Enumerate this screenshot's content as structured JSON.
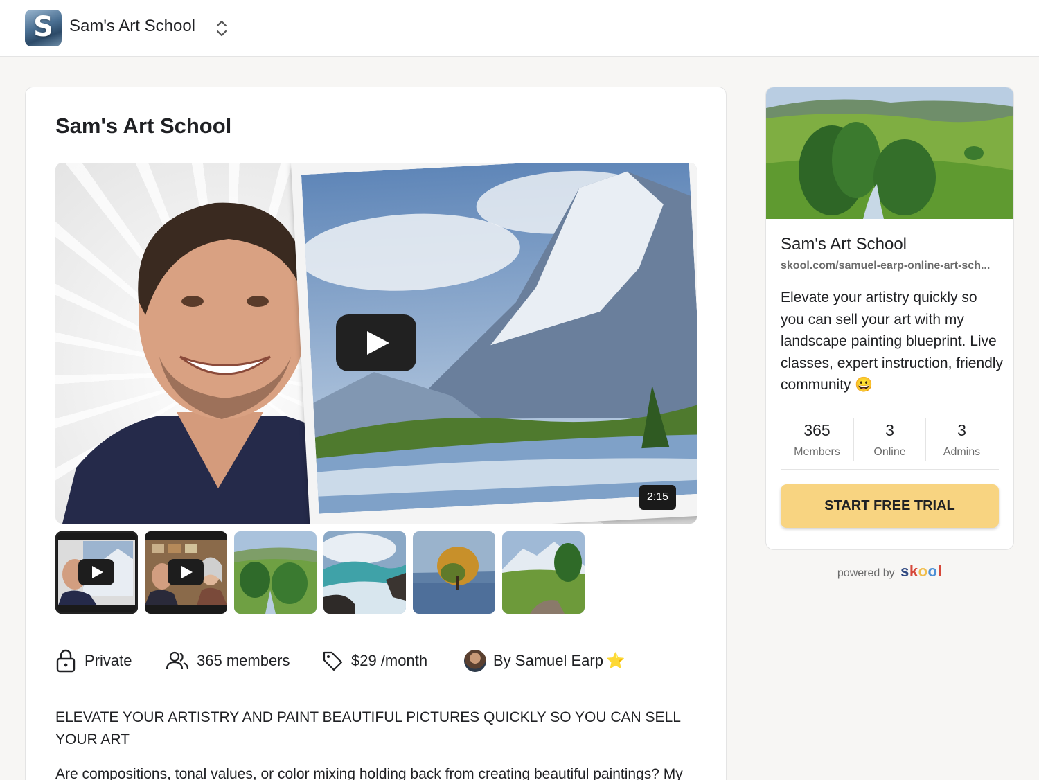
{
  "header": {
    "logo_letter": "S",
    "brand": "Sam's Art School",
    "switcher_icon": "chevron-up-down-icon"
  },
  "main": {
    "title": "Sam's Art School",
    "video": {
      "duration": "2:15",
      "play_icon": "play-icon"
    },
    "thumbnails": [
      {
        "kind": "video",
        "subject": "instructor and mountain painting",
        "active": true
      },
      {
        "kind": "video",
        "subject": "two people in art studio",
        "active": false
      },
      {
        "kind": "image",
        "subject": "green hills landscape painting",
        "active": false
      },
      {
        "kind": "image",
        "subject": "ocean wave seascape painting",
        "active": false
      },
      {
        "kind": "image",
        "subject": "autumn tree by lake painting",
        "active": false
      },
      {
        "kind": "image",
        "subject": "mountain valley stream painting",
        "active": false
      }
    ],
    "meta": {
      "privacy": "Private",
      "members": "365 members",
      "price": "$29 /month",
      "author": "By Samuel Earp",
      "author_badge": "⭐"
    },
    "description_heading": "ELEVATE YOUR ARTISTRY AND PAINT BEAUTIFUL PICTURES QUICKLY SO YOU CAN SELL YOUR ART",
    "description_body": "Are compositions, tonal values, or color mixing holding back from creating beautiful paintings? My"
  },
  "sidebar": {
    "title": "Sam's Art School",
    "url": "skool.com/samuel-earp-online-art-sch...",
    "description": "Elevate your artistry quickly so you can sell your art with my landscape painting blueprint. Live classes, expert instruction, friendly community 😀",
    "stats": [
      {
        "value": "365",
        "label": "Members"
      },
      {
        "value": "3",
        "label": "Online"
      },
      {
        "value": "3",
        "label": "Admins"
      }
    ],
    "cta": "START FREE TRIAL"
  },
  "footer": {
    "powered_by": "powered by",
    "skool_letters": [
      "s",
      "k",
      "o",
      "o",
      "l"
    ]
  },
  "colors": {
    "page_bg": "#f7f6f4",
    "cta_bg": "#f8d481",
    "text": "#202124",
    "muted": "#6b6b6b"
  }
}
